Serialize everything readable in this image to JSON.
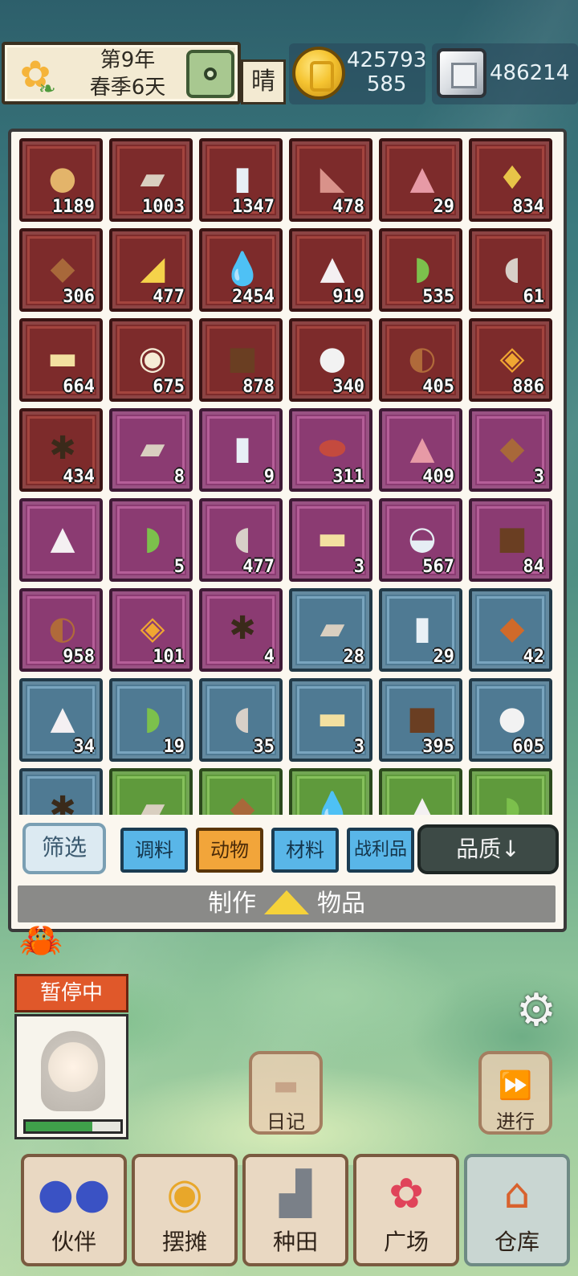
{
  "hud": {
    "date_line1": "第9年",
    "date_line2": "春季6天",
    "weather": "晴",
    "coins_line1": "425793",
    "coins_line2": "585",
    "gems": "486214",
    "icons": [
      "sunflower-icon",
      "map-badge-icon",
      "coin-icon",
      "gem-icon"
    ]
  },
  "inventory": {
    "rows": [
      [
        {
          "icon": "egg",
          "count": "1189",
          "q": "red"
        },
        {
          "icon": "flour",
          "count": "1003",
          "q": "red"
        },
        {
          "icon": "milk",
          "count": "1347",
          "q": "red"
        },
        {
          "icon": "ham",
          "count": "478",
          "q": "red"
        },
        {
          "icon": "sugar",
          "count": "29",
          "q": "red"
        },
        {
          "icon": "oil",
          "count": "834",
          "q": "red"
        }
      ],
      [
        {
          "icon": "meat",
          "count": "306",
          "q": "red"
        },
        {
          "icon": "cheese",
          "count": "477",
          "q": "red"
        },
        {
          "icon": "water",
          "count": "2454",
          "q": "red"
        },
        {
          "icon": "salt",
          "count": "919",
          "q": "red"
        },
        {
          "icon": "cucumber",
          "count": "535",
          "q": "red"
        },
        {
          "icon": "bone",
          "count": "61",
          "q": "red"
        }
      ],
      [
        {
          "icon": "butter",
          "count": "664",
          "q": "red"
        },
        {
          "icon": "cream",
          "count": "675",
          "q": "red"
        },
        {
          "icon": "leather",
          "count": "878",
          "q": "red"
        },
        {
          "icon": "mushroom",
          "count": "340",
          "q": "red"
        },
        {
          "icon": "drumstick",
          "count": "405",
          "q": "red"
        },
        {
          "icon": "honeycomb",
          "count": "886",
          "q": "red"
        }
      ],
      [
        {
          "icon": "spice",
          "count": "434",
          "q": "red"
        },
        {
          "icon": "flour",
          "count": "8",
          "q": "purple"
        },
        {
          "icon": "milk",
          "count": "9",
          "q": "purple"
        },
        {
          "icon": "steak",
          "count": "311",
          "q": "purple"
        },
        {
          "icon": "sugar",
          "count": "409",
          "q": "purple"
        },
        {
          "icon": "meat",
          "count": "3",
          "q": "purple"
        }
      ],
      [
        {
          "icon": "salt",
          "count": "",
          "q": "purple"
        },
        {
          "icon": "cucumber",
          "count": "5",
          "q": "purple"
        },
        {
          "icon": "bone",
          "count": "477",
          "q": "purple"
        },
        {
          "icon": "butter",
          "count": "3",
          "q": "purple"
        },
        {
          "icon": "bowl",
          "count": "567",
          "q": "purple"
        },
        {
          "icon": "leather",
          "count": "84",
          "q": "purple"
        }
      ],
      [
        {
          "icon": "drumstick",
          "count": "958",
          "q": "purple"
        },
        {
          "icon": "honeycomb",
          "count": "101",
          "q": "purple"
        },
        {
          "icon": "spice",
          "count": "4",
          "q": "purple"
        },
        {
          "icon": "flour",
          "count": "28",
          "q": "blue"
        },
        {
          "icon": "milk",
          "count": "29",
          "q": "blue"
        },
        {
          "icon": "roast",
          "count": "42",
          "q": "blue"
        }
      ],
      [
        {
          "icon": "salt",
          "count": "34",
          "q": "blue"
        },
        {
          "icon": "cucumber",
          "count": "19",
          "q": "blue"
        },
        {
          "icon": "bone",
          "count": "35",
          "q": "blue"
        },
        {
          "icon": "butter",
          "count": "3",
          "q": "blue"
        },
        {
          "icon": "leather",
          "count": "395",
          "q": "blue"
        },
        {
          "icon": "mushroom",
          "count": "605",
          "q": "blue"
        }
      ],
      [
        {
          "icon": "spice",
          "count": "",
          "q": "blue"
        },
        {
          "icon": "flour",
          "count": "",
          "q": "green"
        },
        {
          "icon": "meat",
          "count": "",
          "q": "green"
        },
        {
          "icon": "water",
          "count": "",
          "q": "green"
        },
        {
          "icon": "salt",
          "count": "",
          "q": "green"
        },
        {
          "icon": "cucumber",
          "count": "",
          "q": "green"
        }
      ]
    ]
  },
  "filters": {
    "filter_label": "筛选",
    "categories": [
      {
        "label": "调料",
        "active": false
      },
      {
        "label": "动物",
        "active": true
      },
      {
        "label": "材料",
        "active": false
      },
      {
        "label": "战利品",
        "active": false
      }
    ],
    "sort_label": "品质↓"
  },
  "craft": {
    "left": "制作",
    "right": "物品"
  },
  "character": {
    "status": "暂停中",
    "hp_fraction": 0.7
  },
  "actions": {
    "diary": "日记",
    "proceed": "进行"
  },
  "nav": [
    {
      "label": "伙伴",
      "icon": "companions-icon",
      "active": false
    },
    {
      "label": "摆摊",
      "icon": "stall-icon",
      "active": false
    },
    {
      "label": "种田",
      "icon": "watering-can-icon",
      "active": false
    },
    {
      "label": "广场",
      "icon": "flower-icon",
      "active": false
    },
    {
      "label": "仓库",
      "icon": "house-icon",
      "active": true
    }
  ],
  "colors": {
    "quality_red": "#7d2b2b",
    "quality_purple": "#8b3b72",
    "quality_blue": "#4f7a93",
    "quality_green": "#5f9a3c",
    "active_tab": "#f2a53a",
    "inactive_tab": "#59b6e8"
  }
}
